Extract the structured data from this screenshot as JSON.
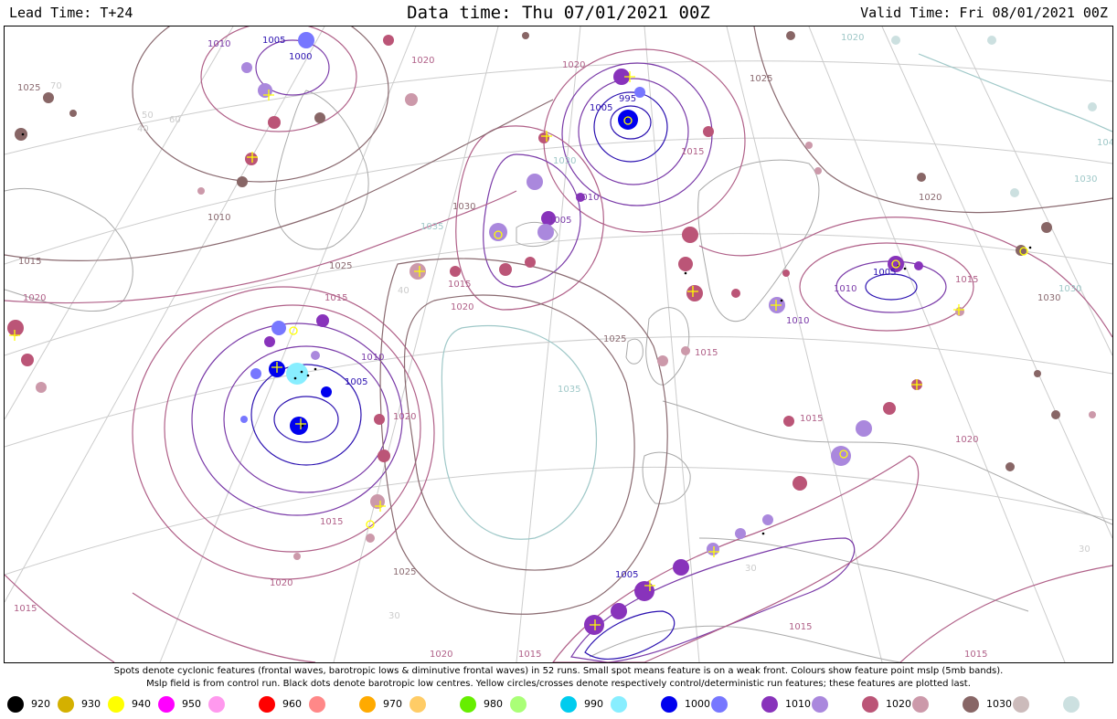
{
  "header": {
    "lead_time": "Lead Time: T+24",
    "data_time": "Data time:  Thu 07/01/2021 00Z",
    "valid_time": "Valid Time: Fri 08/01/2021 00Z"
  },
  "caption": {
    "line1": "Spots denote cyclonic features (frontal waves, barotropic lows & diminutive frontal waves) in 52 runs. Small spot means feature is on a weak front. Colours show feature point mslp (5mb bands).",
    "line2": "Mslp field is from control run. Black dots denote barotropic low centres. Yellow circles/crosses denote respectively control/deterministic run features; these features are plotted last."
  },
  "legend": [
    {
      "label": "920",
      "color": "#000000"
    },
    {
      "label": "930",
      "color": "#d4b000"
    },
    {
      "label": "940",
      "color": "#ffff00"
    },
    {
      "label": "950",
      "color": "#ff00ff"
    },
    {
      "label": "",
      "color": "#ff99ee"
    },
    {
      "label": "960",
      "color": "#ff0000"
    },
    {
      "label": "",
      "color": "#ff8888"
    },
    {
      "label": "970",
      "color": "#ffaa00"
    },
    {
      "label": "",
      "color": "#ffcc66"
    },
    {
      "label": "980",
      "color": "#66ee00"
    },
    {
      "label": "",
      "color": "#aaff77"
    },
    {
      "label": "990",
      "color": "#00ccee"
    },
    {
      "label": "",
      "color": "#88eeff"
    },
    {
      "label": "1000",
      "color": "#0000ee"
    },
    {
      "label": "",
      "color": "#7777ff"
    },
    {
      "label": "1010",
      "color": "#8833bb"
    },
    {
      "label": "",
      "color": "#aa88dd"
    },
    {
      "label": "1020",
      "color": "#bb5577"
    },
    {
      "label": "",
      "color": "#cc99aa"
    },
    {
      "label": "1030",
      "color": "#886666"
    },
    {
      "label": "",
      "color": "#ccbbbb"
    },
    {
      "label": "",
      "color": "#cce0e0"
    }
  ],
  "map": {
    "isobar_labels": [
      "1025",
      "1010",
      "1005",
      "1000",
      "1020",
      "995",
      "1005",
      "1010",
      "1015",
      "1020",
      "1025",
      "1030",
      "1035",
      "1015",
      "1020",
      "1025",
      "1005",
      "1010",
      "1015",
      "1020",
      "1030",
      "1030",
      "1020",
      "1015",
      "1010",
      "1020",
      "1015",
      "1005",
      "1010",
      "1015",
      "1030",
      "1035",
      "1015",
      "1010",
      "1005",
      "1015",
      "1025",
      "1020",
      "1020",
      "1015",
      "1005",
      "1015",
      "1020",
      "1015",
      "1025",
      "1015",
      "1020",
      "1040",
      "1030"
    ],
    "grid_labels": [
      "40",
      "50",
      "60",
      "70",
      "40",
      "30",
      "30",
      "30"
    ],
    "colors": {
      "isobar_high": "#8a6a70",
      "isobar_mid": "#b06088",
      "isobar_low": "#7a3aa8",
      "isobar_deep": "#2a10b0",
      "isobar_cold": "#9fc8c8",
      "grid": "#cccccc",
      "coast": "#a9a9a9"
    }
  }
}
